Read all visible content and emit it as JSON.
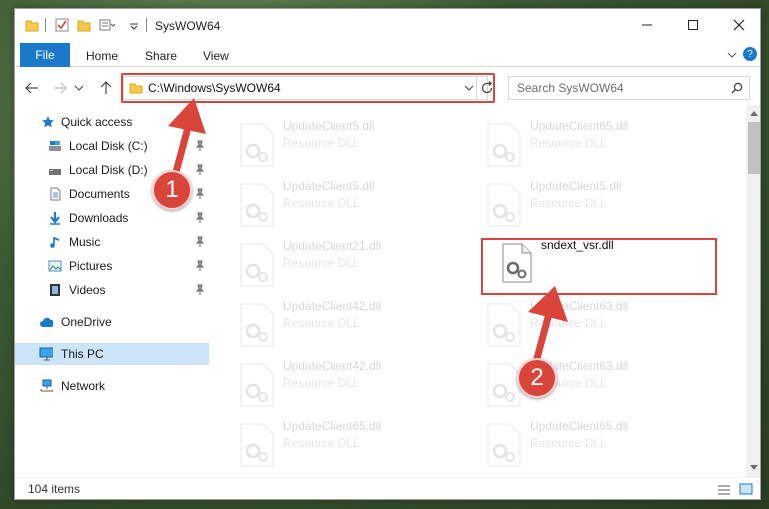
{
  "window": {
    "title": "SysWOW64"
  },
  "ribbon": {
    "file": "File",
    "home": "Home",
    "share": "Share",
    "view": "View"
  },
  "address": {
    "path": "C:\\Windows\\SysWOW64"
  },
  "search": {
    "placeholder": "Search SysWOW64"
  },
  "nav": {
    "quick_access": "Quick access",
    "local_c": "Local Disk (C:)",
    "local_d": "Local Disk (D:)",
    "documents": "Documents",
    "downloads": "Downloads",
    "music": "Music",
    "pictures": "Pictures",
    "videos": "Videos",
    "onedrive": "OneDrive",
    "this_pc": "This PC",
    "network": "Network"
  },
  "files": [
    {
      "name": "UpdateClient5.dll",
      "type": "Resource DLL"
    },
    {
      "name": "UpdateClient65.dll",
      "type": "Resource DLL"
    },
    {
      "name": "UpdateClient5.dll",
      "type": "Resource DLL"
    },
    {
      "name": "UpdateClient5.dll",
      "type": "Resource DLL"
    },
    {
      "name": "UpdateClient21.dll",
      "type": "Resource DLL"
    },
    {
      "name": "sndext_vsr.dll",
      "type": ""
    },
    {
      "name": "UpdateClient42.dll",
      "type": "Resource DLL"
    },
    {
      "name": "UpdateClient63.dll",
      "type": "Resource DLL"
    },
    {
      "name": "UpdateClient42.dll",
      "type": "Resource DLL"
    },
    {
      "name": "UpdateClient63.dll",
      "type": "Resource DLL"
    },
    {
      "name": "UpdateClient65.dll",
      "type": "Resource DLL"
    },
    {
      "name": "UpdateClient65.dll",
      "type": "Resource DLL"
    }
  ],
  "status": {
    "items": "104 items"
  },
  "steps": {
    "one": "1",
    "two": "2"
  },
  "colors": {
    "accent": "#1979ca",
    "highlight": "#d9453b",
    "selection": "#cce4f7"
  }
}
